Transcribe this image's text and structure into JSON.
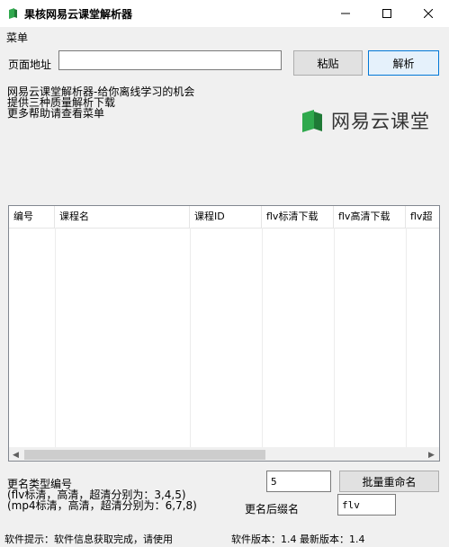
{
  "window": {
    "title": "果核网易云课堂解析器",
    "icons": {
      "app": "app-icon",
      "minimize": "minimize-icon",
      "maximize": "maximize-icon",
      "close": "close-icon"
    }
  },
  "menu": {
    "label": "菜单"
  },
  "url_row": {
    "label": "页面地址",
    "input_value": "",
    "paste_label": "粘贴",
    "parse_label": "解析"
  },
  "info": {
    "line1": "网易云课堂解析器-给你离线学习的机会",
    "line2": "提供三种质量解析下载",
    "line3": "更多帮助请查看菜单"
  },
  "logo": {
    "text": "网易云课堂",
    "color": "#2fa94d"
  },
  "table": {
    "columns": [
      "编号",
      "课程名",
      "课程ID",
      "flv标清下载",
      "flv高清下载",
      "flv超"
    ],
    "rows": []
  },
  "rename": {
    "title": "更名类型编号",
    "flv_note": "(flv标清，高清，超清分别为：3,4,5)",
    "mp4_note": "(mp4标清，高清，超清分别为：6,7,8)",
    "type_value": "5",
    "batch_label": "批量重命名",
    "suffix_label": "更名后缀名",
    "suffix_value": "flv"
  },
  "status": {
    "left": "软件提示：软件信息获取完成，请使用",
    "right": "软件版本：1.4 最新版本：1.4"
  }
}
